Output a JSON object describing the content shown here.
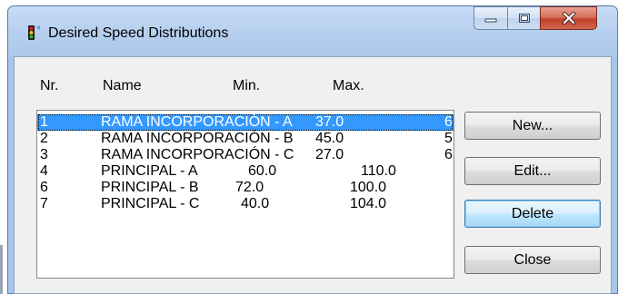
{
  "window": {
    "title": "Desired Speed Distributions",
    "app_icon": "traffic-light-icon",
    "controls": {
      "minimize_icon": "minimize-icon",
      "maximize_icon": "maximize-icon",
      "close_icon": "close-icon"
    }
  },
  "columns": {
    "nr": "Nr.",
    "name": "Name",
    "min": "Min.",
    "max": "Max."
  },
  "rows": [
    {
      "nr": "1",
      "name": "RAMA INCORPORACIÓN - A",
      "min": "37.0",
      "max": "6",
      "selected": true
    },
    {
      "nr": "2",
      "name": "RAMA INCORPORACIÓN - B",
      "min": "45.0",
      "max": "5",
      "selected": false
    },
    {
      "nr": "3",
      "name": "RAMA INCORPORACIÓN - C",
      "min": "27.0",
      "max": "6",
      "selected": false
    },
    {
      "nr": "4",
      "name": "PRINCIPAL - A",
      "min": "60.0",
      "max": "110.0",
      "selected": false
    },
    {
      "nr": "6",
      "name": "PRINCIPAL - B",
      "min": "72.0",
      "max": "100.0",
      "selected": false
    },
    {
      "nr": "7",
      "name": "PRINCIPAL - C",
      "min": "40.0",
      "max": "104.0",
      "selected": false
    }
  ],
  "buttons": {
    "new": "New...",
    "edit": "Edit...",
    "delete": "Delete",
    "close": "Close"
  },
  "colors": {
    "selection": "#3399ff",
    "default_button_border": "#3c7fb1",
    "close_button": "#c1402a"
  }
}
